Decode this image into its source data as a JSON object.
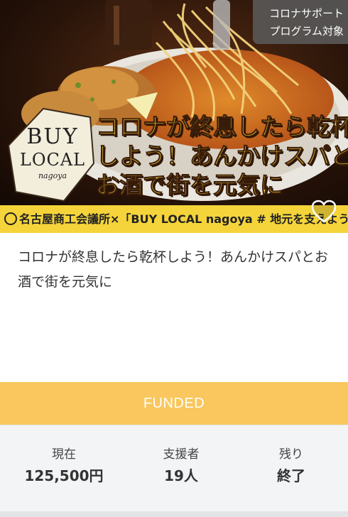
{
  "badge": {
    "line1": "コロナサポート",
    "line2": "プログラム対象"
  },
  "hero": {
    "logo_line1": "BUY",
    "logo_line2": "LOCAL",
    "logo_line3": "nagoya",
    "headline_line1": "コロナが終息したら乾杯",
    "headline_line2": "しよう！あんかけスパと",
    "headline_line3": "お酒で街を元気に",
    "strip_text": "名古屋商工会議所×「BUY LOCAL nagoya # 地元を支えよう」",
    "favorite_icon": "heart-outline-icon"
  },
  "project": {
    "title": "コロナが終息したら乾杯しよう！あんかけスパとお酒で街を元気に",
    "status": "FUNDED"
  },
  "stats": {
    "current_label": "現在",
    "current_value": "125,500円",
    "supporters_label": "支援者",
    "supporters_value": "19人",
    "remaining_label": "残り",
    "remaining_value": "終了"
  },
  "colors": {
    "funded_bg": "#f9c75d",
    "strip_bg": "#f4d43a",
    "headline": "#f6d33a"
  }
}
